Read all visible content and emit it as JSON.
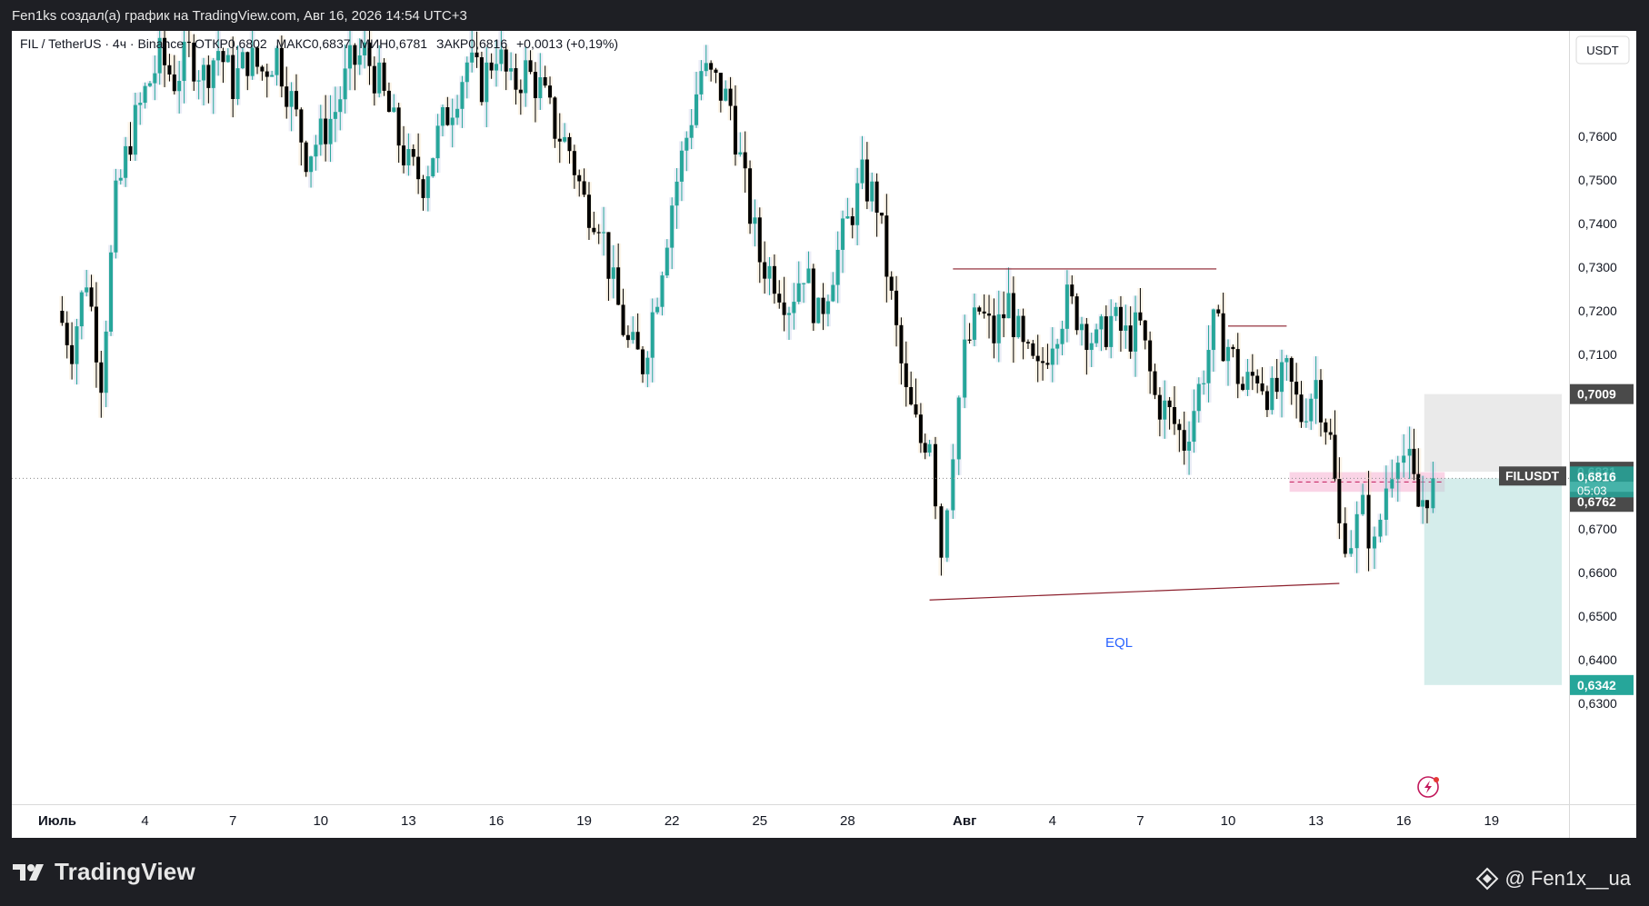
{
  "header": {
    "attribution": "Fen1ks создал(а) график на TradingView.com, Авг 16, 2026 14:54 UTC+3"
  },
  "legend": {
    "symbol": "FIL / TetherUS · 4ч · Binance",
    "open_label": "ОТКР",
    "open": "0,6802",
    "high_label": "МАКС",
    "high": "0,6837",
    "low_label": "МИН",
    "low": "0,6781",
    "close_label": "ЗАКР",
    "close": "0,6816",
    "change": "+0,0013 (+0,19%)"
  },
  "price_axis": {
    "currency": "USDT",
    "ticks": [
      "0,7600",
      "0,7500",
      "0,7400",
      "0,7300",
      "0,7200",
      "0,7100",
      "0,6700",
      "0,6600",
      "0,6500",
      "0,6400",
      "0,6300"
    ]
  },
  "price_labels": {
    "target_high": "0,7009",
    "level_upper": "0,6831",
    "symbol_tag": "FILUSDT",
    "last_price": "0,6816",
    "countdown": "05:03",
    "level_lower": "0,6762",
    "target_low": "0,6342"
  },
  "time_axis": {
    "labels": [
      "Июль",
      "4",
      "7",
      "10",
      "13",
      "16",
      "19",
      "22",
      "25",
      "28",
      "Авг",
      "4",
      "7",
      "10",
      "13",
      "16",
      "19"
    ]
  },
  "annotations": {
    "eql_label": "EQL"
  },
  "footer": {
    "brand": "TradingView",
    "author": "@ Fen1x__ua"
  },
  "colors": {
    "bull": "#26a69a",
    "bear": "#000000",
    "level_line": "#8b1e2b",
    "eql_text": "#2962ff",
    "entry_zone": "#f7b8d6",
    "target_zone": "#b2dfdb",
    "stop_zone": "#d9d9d9",
    "green_label": "#26a69a",
    "dark_label": "#4a4a4a"
  },
  "chart_data": {
    "type": "candlestick",
    "timeframe": "4h",
    "ylim": [
      0.625,
      0.785
    ],
    "x_range_days": [
      1,
      50
    ],
    "last_close": 0.6816,
    "highlighted_levels": [
      0.7009,
      0.6831,
      0.6762,
      0.6342
    ],
    "lines": [
      {
        "kind": "horizontal",
        "from_day": 31.6,
        "to_day": 40.6,
        "price": 0.7296
      },
      {
        "kind": "horizontal",
        "from_day": 41.0,
        "to_day": 43.0,
        "price": 0.7165
      },
      {
        "kind": "segment",
        "from_day": 30.8,
        "from_price": 0.6537,
        "to_day": 44.8,
        "to_price": 0.6575,
        "label": "EQL"
      }
    ],
    "zones": [
      {
        "kind": "entry",
        "from_day": 43.1,
        "to_day": 48.4,
        "top": 0.683,
        "bottom": 0.6785
      },
      {
        "kind": "stop",
        "from_day": 47.7,
        "to_day": 52.4,
        "top": 0.7009,
        "bottom": 0.6831
      },
      {
        "kind": "target",
        "from_day": 47.7,
        "to_day": 52.4,
        "top": 0.6816,
        "bottom": 0.6342
      }
    ],
    "price_path": [
      [
        1,
        0.72
      ],
      [
        1.5,
        0.712
      ],
      [
        2,
        0.728
      ],
      [
        2.5,
        0.705
      ],
      [
        3,
        0.745
      ],
      [
        3.5,
        0.76
      ],
      [
        4,
        0.77
      ],
      [
        4.5,
        0.778
      ],
      [
        5,
        0.773
      ],
      [
        5.5,
        0.779
      ],
      [
        6,
        0.774
      ],
      [
        6.5,
        0.78
      ],
      [
        7,
        0.772
      ],
      [
        7.5,
        0.778
      ],
      [
        8,
        0.775
      ],
      [
        8.5,
        0.779
      ],
      [
        9,
        0.768
      ],
      [
        9.5,
        0.756
      ],
      [
        10,
        0.76
      ],
      [
        10.5,
        0.766
      ],
      [
        11,
        0.776
      ],
      [
        11.5,
        0.779
      ],
      [
        12,
        0.772
      ],
      [
        12.5,
        0.762
      ],
      [
        13,
        0.753
      ],
      [
        13.5,
        0.75
      ],
      [
        14,
        0.76
      ],
      [
        14.5,
        0.768
      ],
      [
        15,
        0.777
      ],
      [
        15.5,
        0.772
      ],
      [
        16,
        0.78
      ],
      [
        16.5,
        0.771
      ],
      [
        17,
        0.775
      ],
      [
        17.5,
        0.771
      ],
      [
        18,
        0.762
      ],
      [
        18.5,
        0.757
      ],
      [
        19,
        0.745
      ],
      [
        19.5,
        0.742
      ],
      [
        20,
        0.725
      ],
      [
        20.5,
        0.712
      ],
      [
        21,
        0.708
      ],
      [
        21.5,
        0.725
      ],
      [
        22,
        0.745
      ],
      [
        22.5,
        0.76
      ],
      [
        23,
        0.775
      ],
      [
        23.5,
        0.772
      ],
      [
        24,
        0.767
      ],
      [
        24.5,
        0.748
      ],
      [
        25,
        0.732
      ],
      [
        25.5,
        0.728
      ],
      [
        26,
        0.722
      ],
      [
        26.5,
        0.73
      ],
      [
        27,
        0.718
      ],
      [
        27.5,
        0.73
      ],
      [
        28,
        0.74
      ],
      [
        28.5,
        0.75
      ],
      [
        29,
        0.745
      ],
      [
        29.5,
        0.722
      ],
      [
        30,
        0.7
      ],
      [
        30.5,
        0.69
      ],
      [
        30.8,
        0.692
      ],
      [
        31.2,
        0.665
      ],
      [
        31.6,
        0.69
      ],
      [
        32,
        0.71
      ],
      [
        32.5,
        0.72
      ],
      [
        33,
        0.714
      ],
      [
        33.5,
        0.722
      ],
      [
        34,
        0.71
      ],
      [
        34.5,
        0.705
      ],
      [
        35,
        0.715
      ],
      [
        35.5,
        0.722
      ],
      [
        36,
        0.718
      ],
      [
        36.5,
        0.712
      ],
      [
        37,
        0.718
      ],
      [
        37.5,
        0.714
      ],
      [
        38,
        0.716
      ],
      [
        38.5,
        0.7
      ],
      [
        39,
        0.696
      ],
      [
        39.5,
        0.69
      ],
      [
        40,
        0.702
      ],
      [
        40.5,
        0.716
      ],
      [
        41,
        0.712
      ],
      [
        41.5,
        0.702
      ],
      [
        42,
        0.706
      ],
      [
        42.5,
        0.7
      ],
      [
        43,
        0.705
      ],
      [
        43.5,
        0.696
      ],
      [
        44,
        0.704
      ],
      [
        44.5,
        0.69
      ],
      [
        44.8,
        0.67
      ],
      [
        45.2,
        0.668
      ],
      [
        45.6,
        0.674
      ],
      [
        46,
        0.665
      ],
      [
        46.4,
        0.68
      ],
      [
        46.8,
        0.69
      ],
      [
        47.2,
        0.684
      ],
      [
        47.5,
        0.675
      ],
      [
        47.8,
        0.679
      ],
      [
        48.0,
        0.6816
      ]
    ]
  }
}
